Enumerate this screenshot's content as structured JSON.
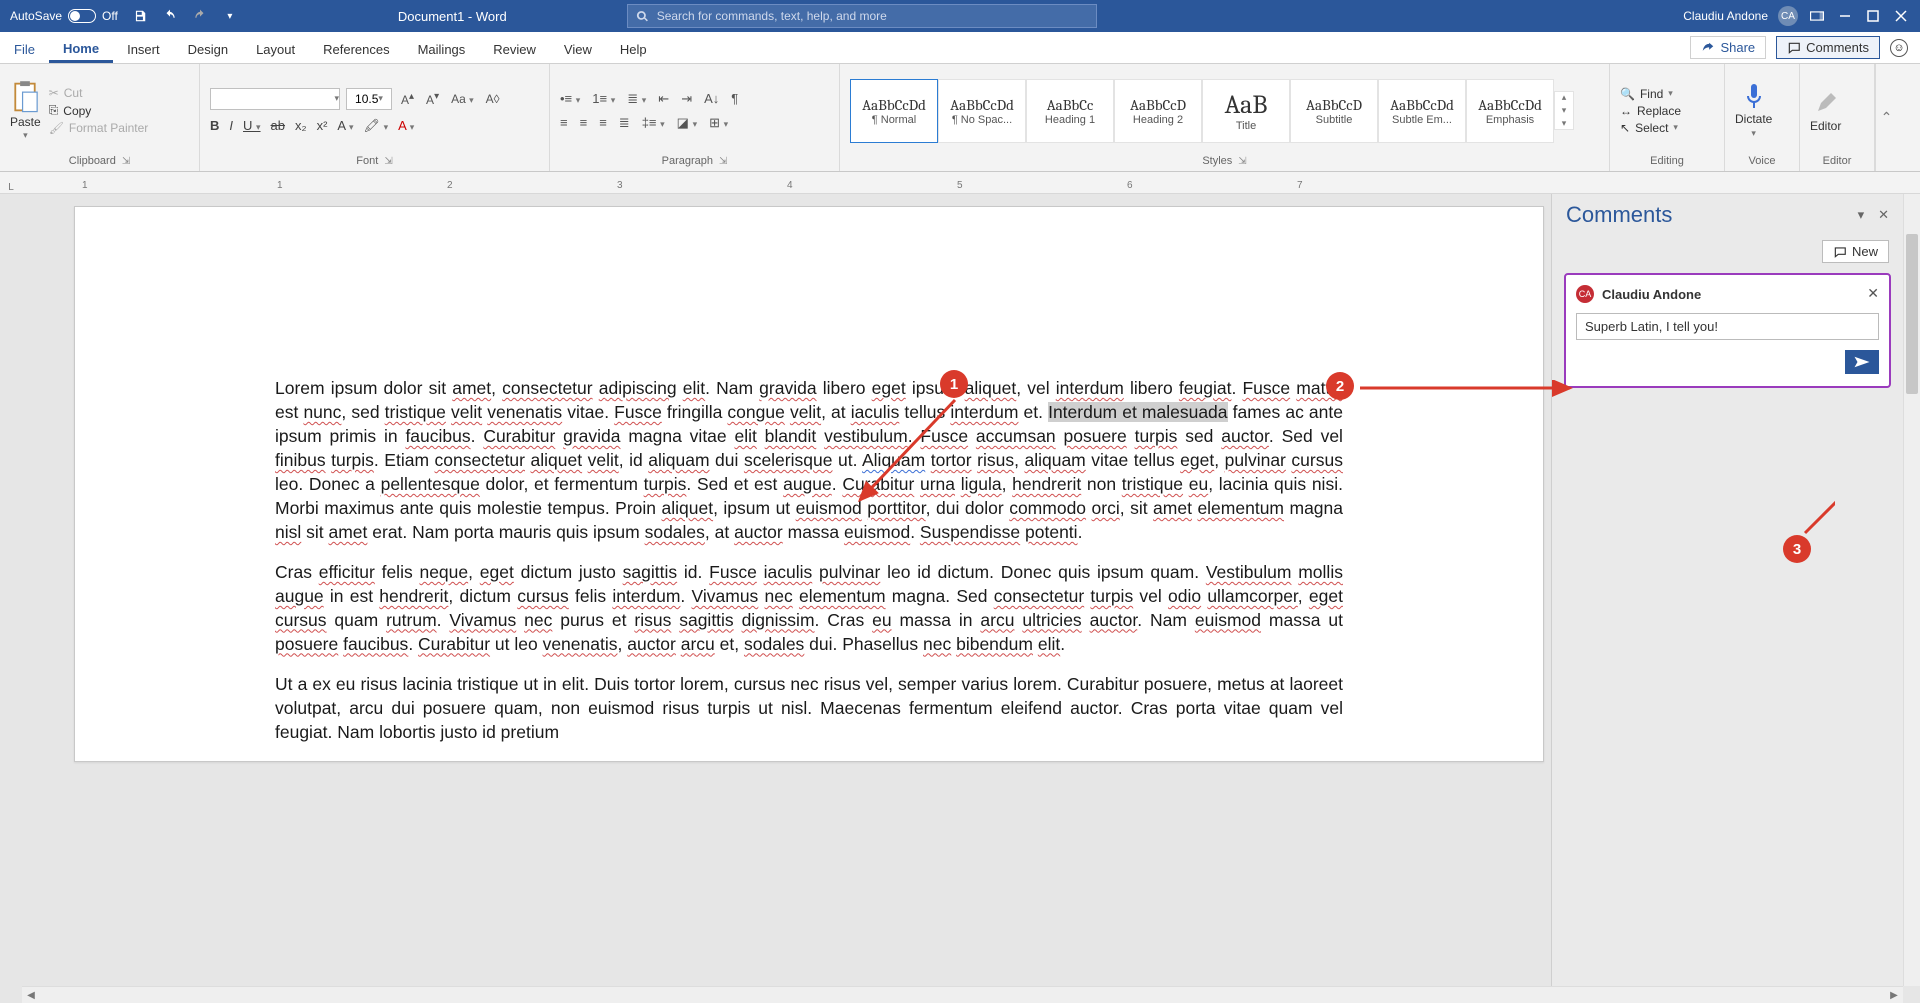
{
  "titlebar": {
    "autosave": "AutoSave",
    "off": "Off",
    "doc_title": "Document1  -  Word",
    "search_placeholder": "Search for commands, text, help, and more",
    "user": "Claudiu Andone",
    "initials": "CA"
  },
  "tabs": {
    "file": "File",
    "home": "Home",
    "insert": "Insert",
    "design": "Design",
    "layout": "Layout",
    "references": "References",
    "mailings": "Mailings",
    "review": "Review",
    "view": "View",
    "help": "Help",
    "share": "Share",
    "comments": "Comments"
  },
  "ribbon": {
    "clipboard": {
      "paste": "Paste",
      "cut": "Cut",
      "copy": "Copy",
      "format_painter": "Format Painter",
      "label": "Clipboard"
    },
    "font": {
      "size": "10.5",
      "grow": "A^",
      "shrink": "A˅",
      "case": "Aa",
      "clear": "A⁰",
      "label": "Font"
    },
    "paragraph": {
      "label": "Paragraph"
    },
    "styles": {
      "label": "Styles",
      "items": [
        {
          "preview": "AaBbCcDd",
          "name": "¶ Normal"
        },
        {
          "preview": "AaBbCcDd",
          "name": "¶ No Spac..."
        },
        {
          "preview": "AaBbCc",
          "name": "Heading 1"
        },
        {
          "preview": "AaBbCcD",
          "name": "Heading 2"
        },
        {
          "preview": "AaB",
          "name": "Title"
        },
        {
          "preview": "AaBbCcD",
          "name": "Subtitle"
        },
        {
          "preview": "AaBbCcDd",
          "name": "Subtle Em..."
        },
        {
          "preview": "AaBbCcDd",
          "name": "Emphasis"
        }
      ]
    },
    "editing": {
      "find": "Find",
      "replace": "Replace",
      "select": "Select",
      "label": "Editing"
    },
    "voice": {
      "dictate": "Dictate",
      "label": "Voice"
    },
    "editor": {
      "editor": "Editor",
      "label": "Editor"
    }
  },
  "ruler": {
    "left": "L",
    "marks": [
      "1",
      "1",
      "2",
      "3",
      "4",
      "5",
      "6",
      "7"
    ]
  },
  "doc": {
    "p1_a": "Lorem ipsum dolor sit ",
    "p1_amet": "amet",
    "p1_b": ", ",
    "p1_cons": "consectetur",
    "p1_c": " ",
    "p1_adip": "adipiscing",
    "p1_d": " ",
    "p1_elit": "elit",
    "p1_e": ". Nam ",
    "p1_grav": "gravida",
    "p1_f": " libero ",
    "p1_eget": "eget",
    "p1_g": " ipsum ",
    "p1_aliq": "aliquet",
    "p1_h": ", vel ",
    "p1_inter": "interdum",
    "p1_i": " libero ",
    "p1_feug": "feugiat",
    "p1_j": ". ",
    "p1_fusce": "Fusce",
    "p1_k": " ",
    "p1_mattis": "mattis",
    "p1_l": " est ",
    "p1_nunc": "nunc",
    "p1_m": ", sed ",
    "p1_tris": "tristique",
    "p1_n": " ",
    "p1_velit": "velit",
    "p1_o": " ",
    "p1_venen": "venenatis",
    "p1_p": " vitae. ",
    "p1_fusce2": "Fusce",
    "p1_q": " fringilla ",
    "p1_congue": "congue",
    "p1_r": " ",
    "p1_velit2": "velit",
    "p1_s": ", at ",
    "p1_iac": "iaculis",
    "p1_t": " tellus ",
    "p1_inter2": "interdum",
    "p1_u": " et. ",
    "p1_sel": "Interdum et malesuada",
    "p1_v": " fames ac ante ipsum primis in ",
    "p1_fauc": "faucibus",
    "p1_w": ". ",
    "p1_cur": "Curabitur",
    "p1_x": " ",
    "p1_grav2": "gravida",
    "p1_y": " magna vitae ",
    "p1_elit2": "elit",
    "p1_z": " ",
    "p1_bland": "blandit",
    "p1_aa": " ",
    "p1_vest": "vestibulum",
    "p1_ab": ". ",
    "p1_fusce3": "Fusce",
    "p1_ac": " ",
    "p1_accum": "accumsan",
    "p1_ad": " ",
    "p1_posu": "posuere",
    "p1_ae": " ",
    "p1_turpis": "turpis",
    "p1_af": " sed ",
    "p1_auctor": "auctor",
    "p1_ag": ". Sed vel ",
    "p1_finib": "finibus",
    "p1_ah": " ",
    "p1_turpis2": "turpis",
    "p1_ai": ". Etiam ",
    "p1_cons2": "consectetur",
    "p1_aj": " ",
    "p1_aliq2": "aliquet",
    "p1_ak": " ",
    "p1_velit3": "velit",
    "p1_al": ", id ",
    "p1_aliquam": "aliquam",
    "p1_am": " dui ",
    "p1_scel": "scelerisque",
    "p1_an": " ut. ",
    "p1_aliquam2": "Aliquam",
    "p1_ao": " ",
    "p1_tortor": "tortor",
    "p1_ap": " ",
    "p1_risus": "risus",
    "p1_aq": ", ",
    "p1_aliquam3": "aliquam",
    "p1_ar": " vitae tellus ",
    "p1_eget2": "eget",
    "p1_as": ", ",
    "p1_pulv": "pulvinar",
    "p1_at": " ",
    "p1_cursus": "cursus",
    "p1_au": " leo. Donec a ",
    "p1_pell": "pellentesque",
    "p1_av": " dolor, et fermentum ",
    "p1_turpis3": "turpis",
    "p1_aw": ". Sed et est ",
    "p1_augue": "augue",
    "p1_ax": ". ",
    "p1_cur2": "Curabitur",
    "p1_ay": " ",
    "p1_urna": "urna",
    "p1_az": " ",
    "p1_ligula": "ligula",
    "p1_ba": ", ",
    "p1_hend": "hendrerit",
    "p1_bb": " non ",
    "p1_tris2": "tristique",
    "p1_bc": " ",
    "p1_eu": "eu",
    "p1_bd": ", lacinia quis nisi. Morbi maximus ante quis molestie tempus. Proin ",
    "p1_aliq3": "aliquet",
    "p1_be": ", ipsum ut ",
    "p1_euis": "euismod",
    "p1_bf": " ",
    "p1_port": "porttitor",
    "p1_bg": ", dui dolor ",
    "p1_comm": "commodo",
    "p1_bh": " ",
    "p1_orci": "orci",
    "p1_bi": ", sit ",
    "p1_amet2": "amet",
    "p1_bj": " ",
    "p1_elem": "elementum",
    "p1_bk": " magna ",
    "p1_nisl": "nisl",
    "p1_bl": " sit ",
    "p1_amet3": "amet",
    "p1_bm": " erat. Nam porta mauris quis ipsum ",
    "p1_sod": "sodales",
    "p1_bn": ", at ",
    "p1_auctor2": "auctor",
    "p1_bo": " massa ",
    "p1_euis2": "euismod",
    "p1_bp": ". ",
    "p1_susp": "Suspendisse",
    "p1_bq": " ",
    "p1_pot": "potenti",
    "p1_br": ".",
    "p2_a": "Cras ",
    "p2_eff": "efficitur",
    "p2_b": " felis ",
    "p2_neq": "neque",
    "p2_c": ", ",
    "p2_eget": "eget",
    "p2_d": " dictum justo ",
    "p2_sag": "sagittis",
    "p2_e": " id. ",
    "p2_fusce": "Fusce",
    "p2_f": " ",
    "p2_iac": "iaculis",
    "p2_g": " ",
    "p2_pulv": "pulvinar",
    "p2_h": " leo id dictum. Donec quis ipsum quam. ",
    "p2_vest": "Vestibulum",
    "p2_i": " ",
    "p2_mollis": "mollis",
    "p2_j": " ",
    "p2_augue": "augue",
    "p2_k": " in est ",
    "p2_hend": "hendrerit",
    "p2_l": ", dictum ",
    "p2_cursus": "cursus",
    "p2_m": " felis ",
    "p2_inter": "interdum",
    "p2_n": ". ",
    "p2_viv": "Vivamus",
    "p2_o": " ",
    "p2_nec": "nec",
    "p2_p": " ",
    "p2_elem": "elementum",
    "p2_q": " magna. Sed ",
    "p2_cons": "consectetur",
    "p2_r": " ",
    "p2_turpis": "turpis",
    "p2_s": " vel ",
    "p2_odio": "odio",
    "p2_t": " ",
    "p2_ull": "ullamcorper",
    "p2_u": ", ",
    "p2_eget2": "eget",
    "p2_v": " ",
    "p2_cursus2": "cursus",
    "p2_w": " quam ",
    "p2_rut": "rutrum",
    "p2_x": ". ",
    "p2_viv2": "Vivamus",
    "p2_y": " ",
    "p2_nec2": "nec",
    "p2_z": " purus et ",
    "p2_risus": "risus",
    "p2_aa": " ",
    "p2_sag2": "sagittis",
    "p2_ab": " ",
    "p2_dign": "dignissim",
    "p2_ac": ". Cras ",
    "p2_eu": "eu",
    "p2_ad": " massa in ",
    "p2_arcu": "arcu",
    "p2_ae": " ",
    "p2_ultr": "ultricies",
    "p2_af": " ",
    "p2_auctor": "auctor",
    "p2_ag": ". Nam ",
    "p2_euis": "euismod",
    "p2_ah": " massa ut ",
    "p2_posu": "posuere",
    "p2_ai": " ",
    "p2_fauc": "faucibus",
    "p2_aj": ". ",
    "p2_cur": "Curabitur",
    "p2_ak": " ut leo ",
    "p2_venen": "venenatis",
    "p2_al": ", ",
    "p2_auctor2": "auctor",
    "p2_am": " ",
    "p2_arcu2": "arcu",
    "p2_an": " et, ",
    "p2_sod": "sodales",
    "p2_ao": " dui. Phasellus ",
    "p2_nec3": "nec",
    "p2_ap": " ",
    "p2_bib": "bibendum",
    "p2_aq": " ",
    "p2_elit": "elit",
    "p2_ar": ".",
    "p3": "Ut a ex eu risus lacinia tristique ut in elit. Duis tortor lorem, cursus nec risus vel, semper varius lorem. Curabitur posuere, metus at laoreet volutpat, arcu dui posuere quam, non euismod risus turpis ut nisl. Maecenas fermentum eleifend auctor. Cras porta vitae quam vel feugiat. Nam lobortis justo id pretium"
  },
  "pane": {
    "title": "Comments",
    "new": "New",
    "author": "Claudiu Andone",
    "avatar": "CA",
    "text": "Superb Latin, I tell you!"
  },
  "callouts": {
    "c1": "1",
    "c2": "2",
    "c3": "3"
  }
}
